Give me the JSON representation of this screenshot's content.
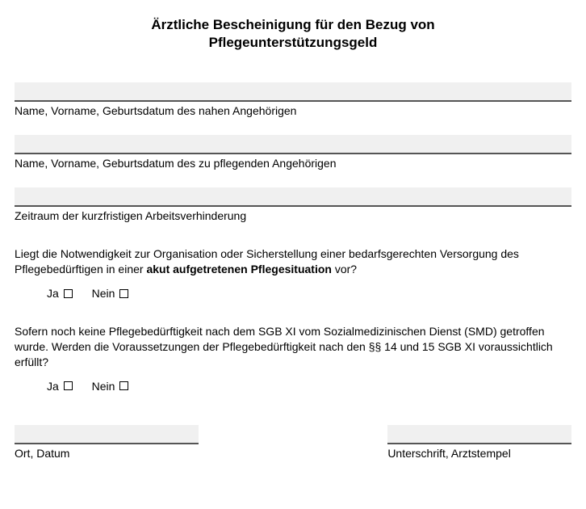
{
  "title_line1": "Ärztliche Bescheinigung für den Bezug von",
  "title_line2": "Pflegeunterstützungsgeld",
  "fields": {
    "relative": {
      "label": "Name, Vorname, Geburtsdatum des nahen Angehörigen",
      "value": ""
    },
    "care_recipient": {
      "label": "Name, Vorname, Geburtsdatum des zu pflegenden Angehörigen",
      "value": ""
    },
    "period": {
      "label": "Zeitraum der kurzfristigen Arbeitsverhinderung",
      "value": ""
    }
  },
  "question1": {
    "pre": "Liegt die Notwendigkeit zur Organisation oder Sicherstellung einer bedarfsgerechten Versorgung des Pflegebedürftigen in einer ",
    "bold": "akut aufgetretenen Pflegesituation",
    "post": " vor?"
  },
  "question2": "Sofern noch keine Pflegebedürftigkeit nach dem SGB XI vom Sozialmedizinischen Dienst (SMD) getroffen wurde. Werden die Voraussetzungen der Pflegebedürftigkeit nach den §§ 14 und 15 SGB XI voraussichtlich erfüllt?",
  "choices": {
    "yes": "Ja",
    "no": "Nein"
  },
  "signature": {
    "place_date": {
      "label": "Ort, Datum",
      "value": ""
    },
    "doctor": {
      "label": "Unterschrift, Arztstempel",
      "value": ""
    }
  }
}
